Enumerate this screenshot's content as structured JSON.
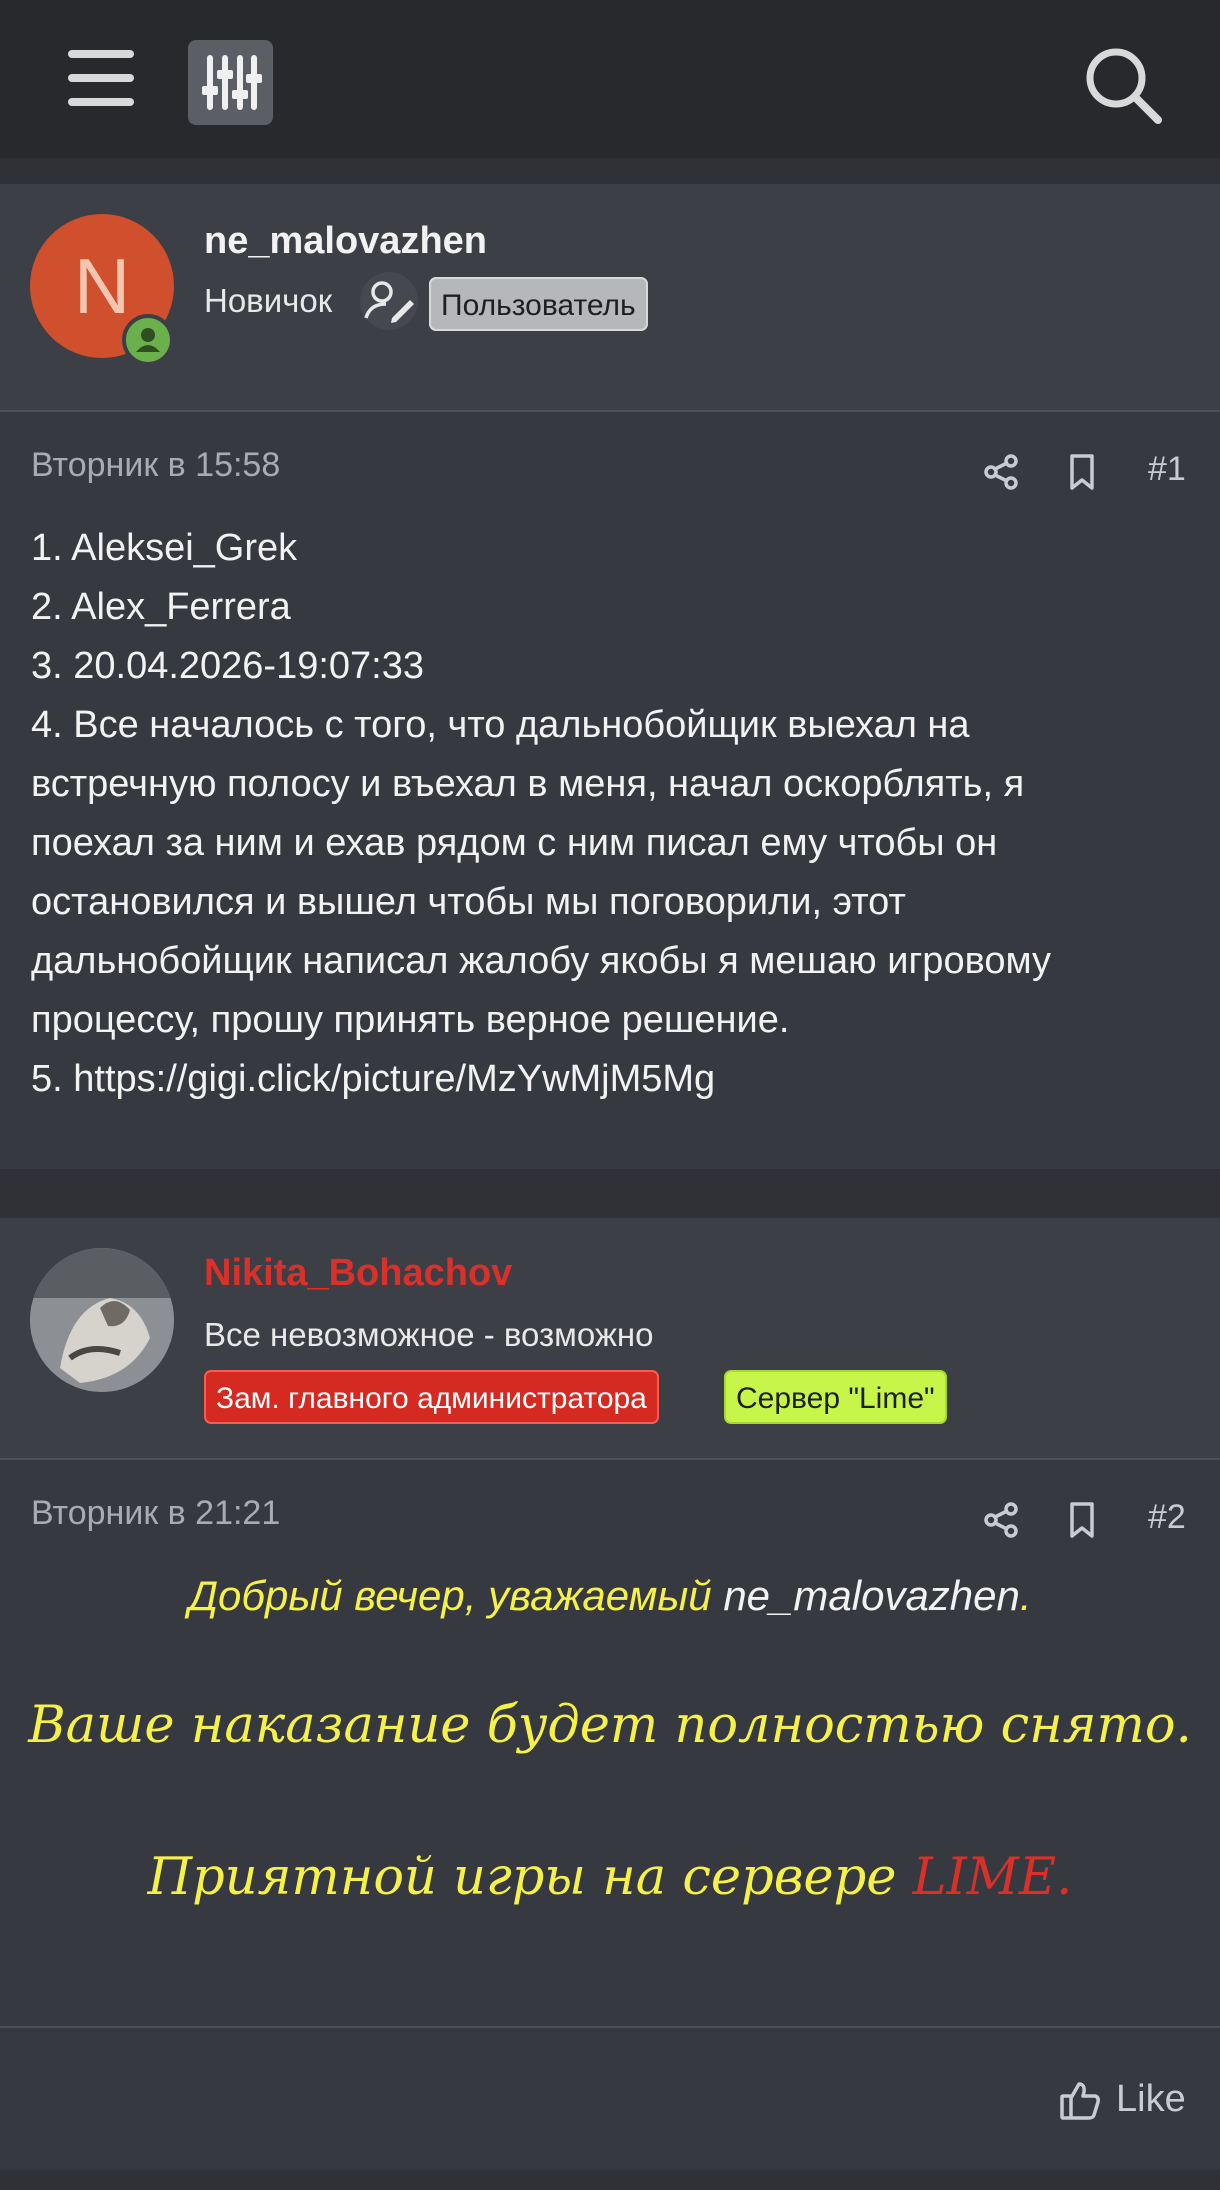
{
  "colors": {
    "accent_red": "#d9312a",
    "yellow_text": "#f5f04a",
    "lime_badge": "#c8f54a",
    "online_green": "#6ab04c"
  },
  "icons": {
    "menu": "menu-icon",
    "filter": "filter-sliders-icon",
    "search": "search-icon",
    "share": "share-icon",
    "bookmark": "bookmark-icon",
    "like": "thumbs-up-icon",
    "user_edit": "user-edit-icon"
  },
  "posts": [
    {
      "avatar_letter": "N",
      "username": "ne_malovazhen",
      "user_title": "Новичок",
      "badge": "Пользователь",
      "date": "Вторник в 15:58",
      "number": "#1",
      "lines": [
        "1. Aleksei_Grek",
        "2. Alex_Ferrera",
        "3. 20.04.2026-19:07:33",
        "4. Все началось с того, что дальнобойщик выехал на",
        "встречную полосу и въехал в меня, начал оскорблять, я",
        "поехал за ним и ехав рядом с ним писал ему чтобы он",
        "остановился и вышел чтобы мы поговорили, этот",
        "дальнобойщик написал жалобу якобы я мешаю игровому",
        "процессу, прошу принять верное решение.",
        "5. https://gigi.click/picture/MzYwMjM5Mg"
      ]
    },
    {
      "username": "Nikita_Bohachov",
      "user_title": "Все невозможное - возможно",
      "badge_admin": "Зам. главного администратора",
      "badge_server": "Сервер \"Lime\"",
      "date": "Вторник в 21:21",
      "number": "#2",
      "greeting_part1": "Добрый вечер, уважаемый ",
      "greeting_name": "ne_malovazhen",
      "greeting_end": ".",
      "verdict": "Ваше наказание будет полностью снято.",
      "farewell_part1": "Приятной игры на сервере ",
      "farewell_server": "LIME.",
      "like_label": "Like"
    }
  ]
}
